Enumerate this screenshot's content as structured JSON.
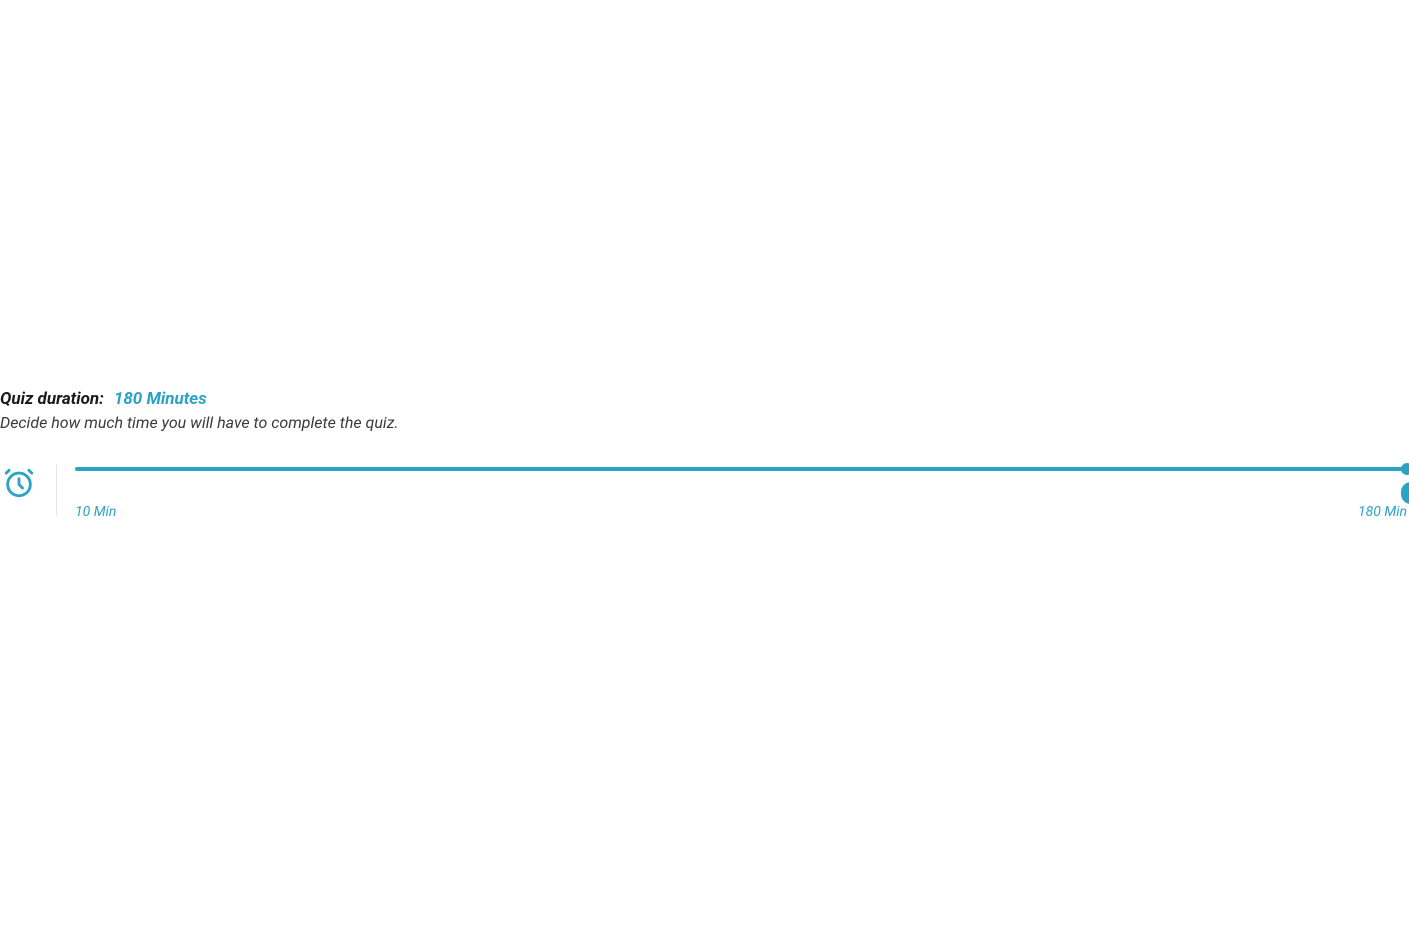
{
  "duration": {
    "label": "Quiz duration:",
    "current_value": "180 Minutes",
    "description": "Decide how much time you will have to complete the quiz.",
    "min_label": "10 Min",
    "max_label": "180 Min"
  },
  "colors": {
    "accent": "#2aa3c4"
  }
}
